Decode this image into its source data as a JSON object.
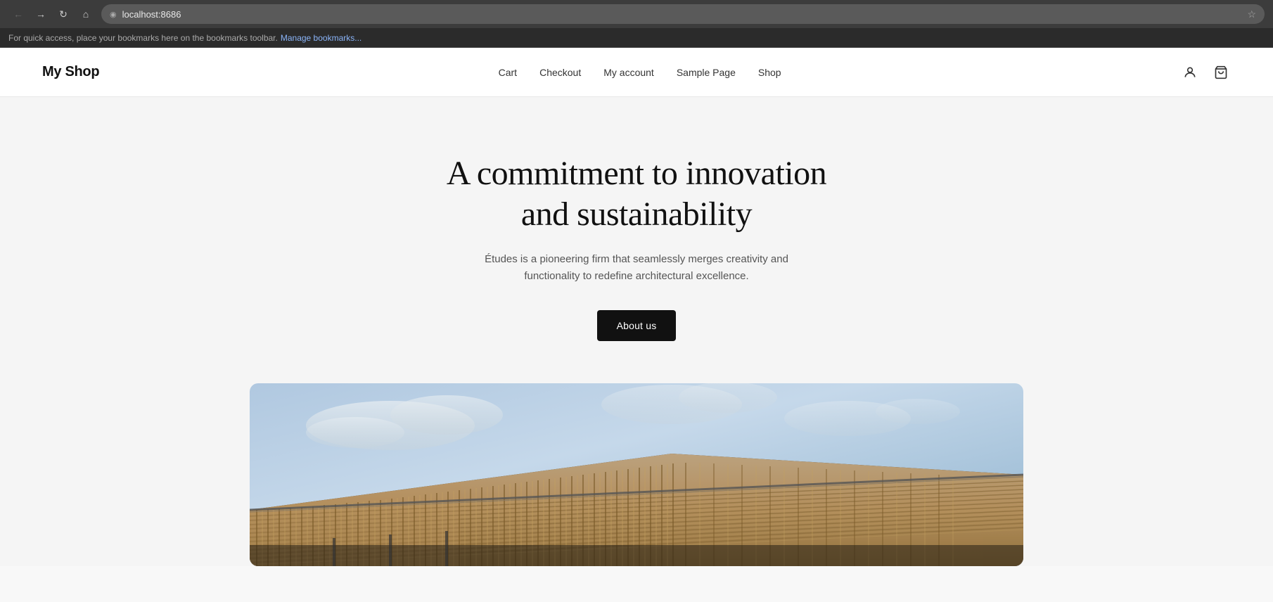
{
  "browser": {
    "url": "localhost:8686",
    "bookmark_bar_text": "For quick access, place your bookmarks here on the bookmarks toolbar.",
    "manage_bookmarks_label": "Manage bookmarks...",
    "nav": {
      "back_title": "Back",
      "forward_title": "Forward",
      "reload_title": "Reload",
      "home_title": "Home"
    }
  },
  "site": {
    "logo": "My Shop",
    "nav": {
      "links": [
        {
          "label": "Cart",
          "href": "#"
        },
        {
          "label": "Checkout",
          "href": "#"
        },
        {
          "label": "My account",
          "href": "#"
        },
        {
          "label": "Sample Page",
          "href": "#"
        },
        {
          "label": "Shop",
          "href": "#"
        }
      ]
    },
    "hero": {
      "title_line1": "A commitment to innovation",
      "title_line2": "and sustainability",
      "subtitle": "Études is a pioneering firm that seamlessly merges creativity and functionality to redefine architectural excellence.",
      "cta_label": "About us"
    }
  }
}
